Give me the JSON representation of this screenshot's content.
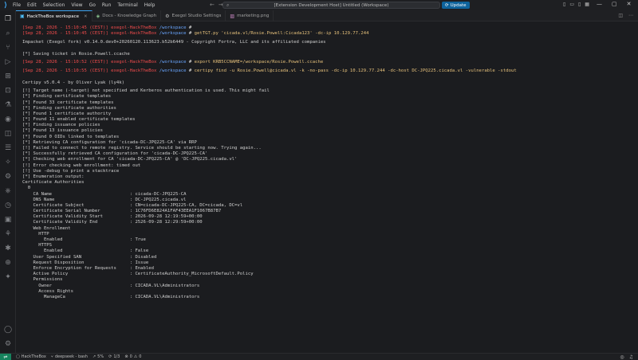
{
  "menu": [
    "File",
    "Edit",
    "Selection",
    "View",
    "Go",
    "Run",
    "Terminal",
    "Help"
  ],
  "command_center": {
    "text": "[Extension Development Host] Untitled (Workspace)"
  },
  "update_label": "Update",
  "tabs": [
    {
      "label": "HackTheBox workspace",
      "active": true
    },
    {
      "label": "Docs - Knowledge Graph",
      "active": false
    },
    {
      "label": "Exegol Studio Settings",
      "active": false
    },
    {
      "label": "marketing.png",
      "active": false
    }
  ],
  "prompt": {
    "user": "exegol-HackTheBox",
    "dir": "/workspace",
    "sep": "#"
  },
  "terminal_lines": [
    {
      "ts": "[Sep 28, 2026 - 15:10:45 (CEST)]",
      "cmd": ""
    },
    {
      "ts": "[Sep 28, 2026 - 15:10:45 (CEST)]",
      "cmd": "getTGT.py 'cicada.vl/Rosie.Powell:Cicada123' -dc-ip 10.129.77.244"
    },
    {
      "text": "Impacket (Exegol fork) v0.14.0.dev0+20260120.113623.b52b6449 - Copyright Fortra, LLC and its affiliated companies"
    },
    {
      "text": "[*] Saving ticket in Rosie.Powell.ccache"
    },
    {
      "ts": "[Sep 28, 2026 - 15:10:52 (CEST)]",
      "cmd": "export KRB5CCNAME=/workspace/Rosie.Powell.ccache"
    },
    {
      "ts": "[Sep 28, 2026 - 15:10:55 (CEST)]",
      "cmd": "certipy find -u Rosie.Powell@cicada.vl -k -no-pass -dc-ip 10.129.77.244 -dc-host DC-JPQ225.cicada.vl -vulnerable -stdout"
    },
    {
      "text": "Certipy v5.0.4 - by Oliver Lyak (ly4k)"
    },
    {
      "text": "[!] Target name (-target) not specified and Kerberos authentication is used. This might fail"
    },
    {
      "text": "[*] Finding certificate templates"
    },
    {
      "text": "[*] Found 33 certificate templates"
    },
    {
      "text": "[*] Finding certificate authorities"
    },
    {
      "text": "[*] Found 1 certificate authority"
    },
    {
      "text": "[*] Found 11 enabled certificate templates"
    },
    {
      "text": "[*] Finding issuance policies"
    },
    {
      "text": "[*] Found 13 issuance policies"
    },
    {
      "text": "[*] Found 0 OIDs linked to templates"
    },
    {
      "text": "[*] Retrieving CA configuration for 'cicada-DC-JPQ225-CA' via RRP"
    },
    {
      "text": "[!] Failed to connect to remote registry. Service should be starting now. Trying again..."
    },
    {
      "text": "[*] Successfully retrieved CA configuration for 'cicada-DC-JPQ225-CA'"
    },
    {
      "text": "[*] Checking web enrollment for CA 'cicada-DC-JPQ225-CA' @ 'DC-JPQ225.cicada.vl'"
    },
    {
      "text": "[!] Error checking web enrollment: timed out"
    },
    {
      "text": "[!] Use -debug to print a stacktrace"
    },
    {
      "text": "[*] Enumeration output:"
    },
    {
      "text": "Certificate Authorities"
    },
    {
      "text": "  0"
    },
    {
      "text": "    CA Name                             : cicada-DC-JPQ225-CA"
    },
    {
      "text": "    DNS Name                            : DC-JPQ225.cicada.vl"
    },
    {
      "text": "    Certificate Subject                 : CN=cicada-DC-JPQ225-CA, DC=cicada, DC=vl"
    },
    {
      "text": "    Certificate Serial Number           : 1C76FD6E824A1FAF43EEA1F1067B87B7"
    },
    {
      "text": "    Certificate Validity Start          : 2026-09-28 12:19:59+00:00"
    },
    {
      "text": "    Certificate Validity End            : 2526-09-28 12:29:59+00:00"
    },
    {
      "text": "    Web Enrollment"
    },
    {
      "text": "      HTTP"
    },
    {
      "text": "        Enabled                         : True"
    },
    {
      "text": "      HTTPS"
    },
    {
      "text": "        Enabled                         : False"
    },
    {
      "text": "    User Specified SAN                  : Disabled"
    },
    {
      "text": "    Request Disposition                 : Issue"
    },
    {
      "text": "    Enforce Encryption for Requests     : Enabled"
    },
    {
      "text": "    Active Policy                       : CertificateAuthority_MicrosoftDefault.Policy"
    },
    {
      "text": "    Permissions"
    },
    {
      "text": "      Owner                             : CICADA.VL\\Administrators"
    },
    {
      "text": "      Access Rights"
    },
    {
      "text": "        ManageCa                        : CICADA.VL\\Administrators"
    }
  ],
  "statusbar": {
    "workspace": "HackTheBox",
    "shell": "deepseek - bash",
    "percent": "5%",
    "count": "1/3",
    "errors": "0",
    "warnings": "0"
  },
  "icons": {
    "activity_top": [
      "files-icon",
      "search-icon",
      "source-control-icon",
      "run-debug-icon",
      "extensions-icon",
      "remote-icon",
      "testing-icon",
      "exegol-icon",
      "containers-icon",
      "docs-icon",
      "ai-icon",
      "graph-icon",
      "settings-sync-icon",
      "history-icon",
      "terminal-icon",
      "flask-icon",
      "bug-icon",
      "plugin-icon",
      "star-icon"
    ],
    "activity_bottom": [
      "account-icon",
      "manage-gear-icon"
    ]
  }
}
